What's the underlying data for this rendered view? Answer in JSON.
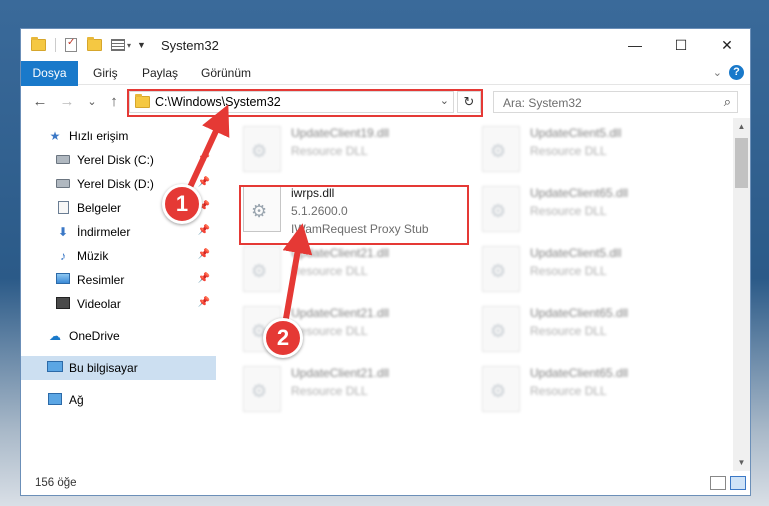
{
  "window": {
    "title": "System32",
    "controls": {
      "minimize": "—",
      "maximize": "☐",
      "close": "✕"
    }
  },
  "ribbon": {
    "tabs": [
      "Dosya",
      "Giriş",
      "Paylaş",
      "Görünüm"
    ],
    "collapse_chevron": "⌄",
    "help": "?"
  },
  "navbar": {
    "back": "←",
    "forward": "→",
    "recent": "⌄",
    "up": "↑",
    "address": "C:\\Windows\\System32",
    "address_dropdown": "⌄",
    "refresh": "↻",
    "search_placeholder": "Ara: System32",
    "search_icon": "search-icon"
  },
  "sidebar": {
    "items": [
      {
        "label": "Hızlı erişim",
        "icon": "star-icon",
        "pinned": false
      },
      {
        "label": "Yerel Disk (C:)",
        "icon": "drive-icon",
        "pinned": true
      },
      {
        "label": "Yerel Disk (D:)",
        "icon": "drive-icon",
        "pinned": true
      },
      {
        "label": "Belgeler",
        "icon": "documents-icon",
        "pinned": true
      },
      {
        "label": "İndirmeler",
        "icon": "downloads-icon",
        "pinned": true
      },
      {
        "label": "Müzik",
        "icon": "music-icon",
        "pinned": true
      },
      {
        "label": "Resimler",
        "icon": "pictures-icon",
        "pinned": true
      },
      {
        "label": "Videolar",
        "icon": "videos-icon",
        "pinned": true
      },
      {
        "label": "OneDrive",
        "icon": "onedrive-icon",
        "pinned": false
      },
      {
        "label": "Bu bilgisayar",
        "icon": "this-pc-icon",
        "pinned": false,
        "selected": true
      },
      {
        "label": "Ağ",
        "icon": "network-icon",
        "pinned": false
      }
    ]
  },
  "files": {
    "col1": [
      {
        "name": "UpdateClient19.dll",
        "type": "Resource DLL"
      },
      {
        "name": "iwrps.dll",
        "version": "5.1.2600.0",
        "description": "IWamRequest Proxy Stub",
        "highlighted": true
      },
      {
        "name": "UpdateClient21.dll",
        "type": "Resource DLL"
      },
      {
        "name": "UpdateClient21.dll",
        "type": "Resource DLL"
      },
      {
        "name": "UpdateClient21.dll",
        "type": "Resource DLL"
      }
    ],
    "col2": [
      {
        "name": "UpdateClient5.dll",
        "type": "Resource DLL"
      },
      {
        "name": "UpdateClient65.dll",
        "type": "Resource DLL"
      },
      {
        "name": "UpdateClient5.dll",
        "type": "Resource DLL"
      },
      {
        "name": "UpdateClient65.dll",
        "type": "Resource DLL"
      },
      {
        "name": "UpdateClient65.dll",
        "type": "Resource DLL"
      }
    ]
  },
  "status": {
    "item_count": "156 öğe"
  },
  "callouts": [
    "1",
    "2"
  ],
  "colors": {
    "accent": "#1979ca",
    "highlight": "#e53935",
    "selected": "#ccdff1"
  }
}
